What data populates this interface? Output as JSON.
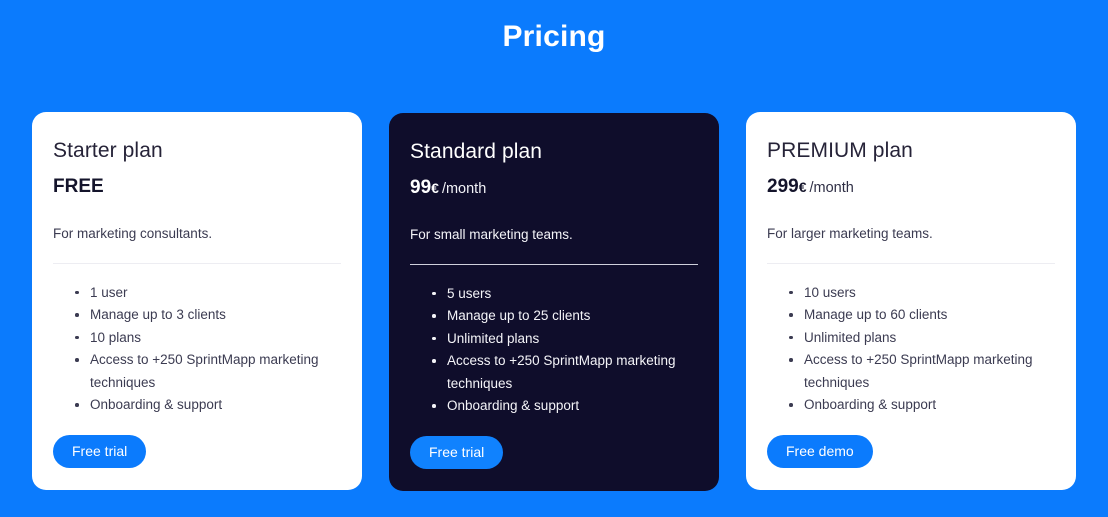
{
  "header": {
    "title": "Pricing"
  },
  "theme": {
    "background": "#0b7bfd",
    "accent": "#0b7bfd",
    "card_light_bg": "#ffffff",
    "card_dark_bg": "#0f0d2b",
    "text_dark": "#3b3b51",
    "text_light": "#f4f4f8"
  },
  "plans": [
    {
      "name": "Starter plan",
      "price_amount": "FREE",
      "price_currency": "",
      "price_period": "",
      "description": "For marketing consultants.",
      "features": [
        "1 user",
        "Manage up to 3 clients",
        "10 plans",
        "Access to +250 SprintMapp marketing techniques",
        "Onboarding & support"
      ],
      "cta_label": "Free trial"
    },
    {
      "name": "Standard plan",
      "price_amount": "99",
      "price_currency": "€",
      "price_period": "/month",
      "description": "For small marketing teams.",
      "features": [
        "5 users",
        "Manage up to 25 clients",
        "Unlimited plans",
        "Access to +250 SprintMapp marketing techniques",
        "Onboarding & support"
      ],
      "cta_label": "Free trial"
    },
    {
      "name": "PREMIUM plan",
      "price_amount": "299",
      "price_currency": "€",
      "price_period": "/month",
      "description": "For larger marketing teams.",
      "features": [
        "10 users",
        "Manage up to 60 clients",
        "Unlimited plans",
        "Access to +250 SprintMapp marketing techniques",
        "Onboarding & support"
      ],
      "cta_label": "Free demo"
    }
  ]
}
